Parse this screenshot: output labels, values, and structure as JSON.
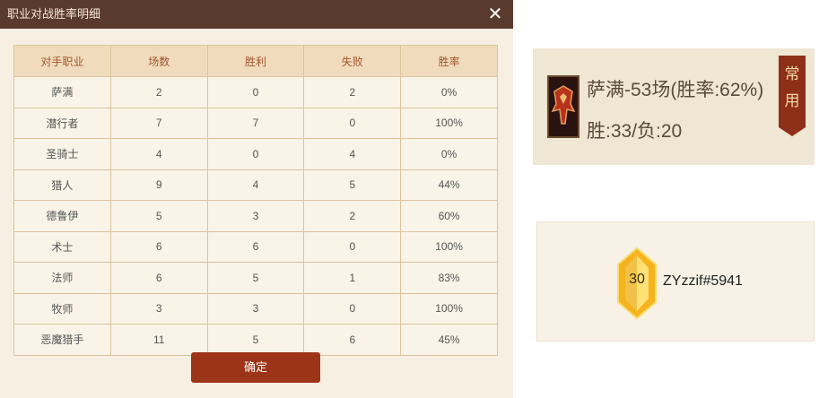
{
  "dialog": {
    "title": "职业对战胜率明细",
    "close_icon": "close-icon",
    "headers": [
      "对手职业",
      "场数",
      "胜利",
      "失败",
      "胜率"
    ],
    "rows": [
      [
        "萨满",
        "2",
        "0",
        "2",
        "0%"
      ],
      [
        "潜行者",
        "7",
        "7",
        "0",
        "100%"
      ],
      [
        "圣骑士",
        "4",
        "0",
        "4",
        "0%"
      ],
      [
        "猎人",
        "9",
        "4",
        "5",
        "44%"
      ],
      [
        "德鲁伊",
        "5",
        "3",
        "2",
        "60%"
      ],
      [
        "术士",
        "6",
        "6",
        "0",
        "100%"
      ],
      [
        "法师",
        "6",
        "5",
        "1",
        "83%"
      ],
      [
        "牧师",
        "3",
        "3",
        "0",
        "100%"
      ],
      [
        "恶魔猎手",
        "11",
        "5",
        "6",
        "45%"
      ]
    ],
    "confirm_label": "确定"
  },
  "class_card": {
    "icon": "shaman-class-icon",
    "summary": "萨满-53场(胜率:62%)",
    "record": "胜:33/负:20",
    "flag_text": "常用"
  },
  "player_card": {
    "badge_icon": "rank-badge-icon",
    "level": "30",
    "player_name": "ZYzzif#5941"
  }
}
